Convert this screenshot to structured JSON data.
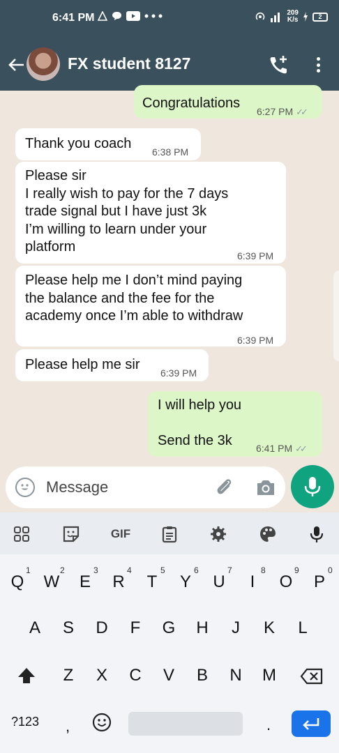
{
  "status_bar": {
    "time": "6:41 PM",
    "speed_top": "209",
    "speed_bottom": "K/s",
    "battery": "2",
    "icons": [
      "warning-triangle-icon",
      "chat-bubble-icon",
      "youtube-icon",
      "more-dots-icon",
      "hotspot-icon",
      "signal-icon",
      "charging-icon",
      "battery-icon"
    ]
  },
  "header": {
    "contact_name": "FX student 8127",
    "icons": [
      "back-arrow-icon",
      "add-call-icon",
      "overflow-menu-icon"
    ]
  },
  "messages": [
    {
      "direction": "out",
      "lines": [
        "Congratulations"
      ],
      "time": "6:27 PM",
      "read": true
    },
    {
      "direction": "in",
      "lines": [
        "Thank you coach"
      ],
      "time": "6:38 PM"
    },
    {
      "direction": "in",
      "lines": [
        "Please sir",
        "I really wish to pay for the 7 days",
        "trade signal but I have just 3k",
        "I’m willing to learn under your",
        "platform"
      ],
      "time": "6:39 PM"
    },
    {
      "direction": "in",
      "lines": [
        "Please help me I don’t mind paying",
        "the balance and the fee for the",
        "academy once I’m able to withdraw"
      ],
      "time": "6:39 PM"
    },
    {
      "direction": "in",
      "lines": [
        "Please help me sir"
      ],
      "time": "6:39 PM"
    },
    {
      "direction": "out",
      "lines": [
        "I will help you",
        "",
        "Send the 3k"
      ],
      "time": "6:41 PM",
      "read": true
    }
  ],
  "composer": {
    "placeholder": "Message",
    "accent_color": "#0fa47f"
  },
  "keyboard": {
    "toolbar": {
      "gif_label": "GIF"
    },
    "row1": [
      "Q",
      "W",
      "E",
      "R",
      "T",
      "Y",
      "U",
      "I",
      "O",
      "P"
    ],
    "row1_hints": [
      "1",
      "2",
      "3",
      "4",
      "5",
      "6",
      "7",
      "8",
      "9",
      "0"
    ],
    "row2": [
      "A",
      "S",
      "D",
      "F",
      "G",
      "H",
      "J",
      "K",
      "L"
    ],
    "row3": [
      "Z",
      "X",
      "C",
      "V",
      "B",
      "N",
      "M"
    ],
    "symbols_label": "?123",
    "comma": ",",
    "period": ".",
    "enter_color": "#1a73e8"
  }
}
